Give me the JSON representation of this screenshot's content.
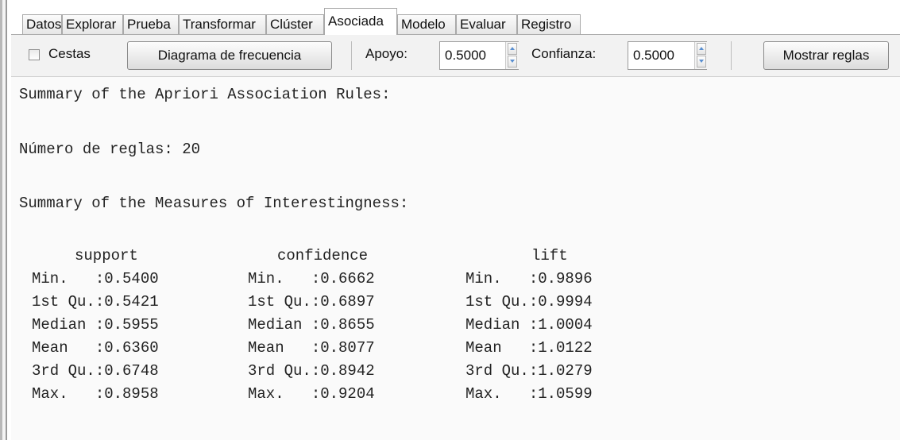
{
  "tabs": [
    {
      "label": "Datos",
      "active": false
    },
    {
      "label": "Explorar",
      "active": false
    },
    {
      "label": "Prueba",
      "active": false
    },
    {
      "label": "Transformar",
      "active": false
    },
    {
      "label": "Clúster",
      "active": false
    },
    {
      "label": "Asociada",
      "active": true
    },
    {
      "label": "Modelo",
      "active": false
    },
    {
      "label": "Evaluar",
      "active": false
    },
    {
      "label": "Registro",
      "active": false
    }
  ],
  "toolbar": {
    "baskets_label": "Cestas",
    "baskets_checked": false,
    "freq_plot_label": "Diagrama de frecuencia",
    "support_label": "Apoyo:",
    "support_value": "0.5000",
    "confidence_label": "Confianza:",
    "confidence_value": "0.5000",
    "show_rules_label": "Mostrar reglas"
  },
  "output": {
    "summary_title": "Summary of the Apriori Association Rules:",
    "rules_count_line": "Número de reglas: 20",
    "measures_title": "Summary of the Measures of Interestingness:",
    "columns": [
      "support",
      "confidence",
      "lift"
    ],
    "rows": [
      [
        "Min.   :0.5400",
        "Min.   :0.6662",
        "Min.   :0.9896"
      ],
      [
        "1st Qu.:0.5421",
        "1st Qu.:0.6897",
        "1st Qu.:0.9994"
      ],
      [
        "Median :0.5955",
        "Median :0.8655",
        "Median :1.0004"
      ],
      [
        "Mean   :0.6360",
        "Mean   :0.8077",
        "Mean   :1.0122"
      ],
      [
        "3rd Qu.:0.6748",
        "3rd Qu.:0.8942",
        "3rd Qu.:1.0279"
      ],
      [
        "Max.   :0.8958",
        "Max.   :0.9204",
        "Max.   :1.0599"
      ]
    ]
  },
  "colors": {
    "toolbar_bg": "#f2f2f2",
    "output_bg": "#fafafa",
    "spinner_arrow": "#5a8fd0"
  }
}
